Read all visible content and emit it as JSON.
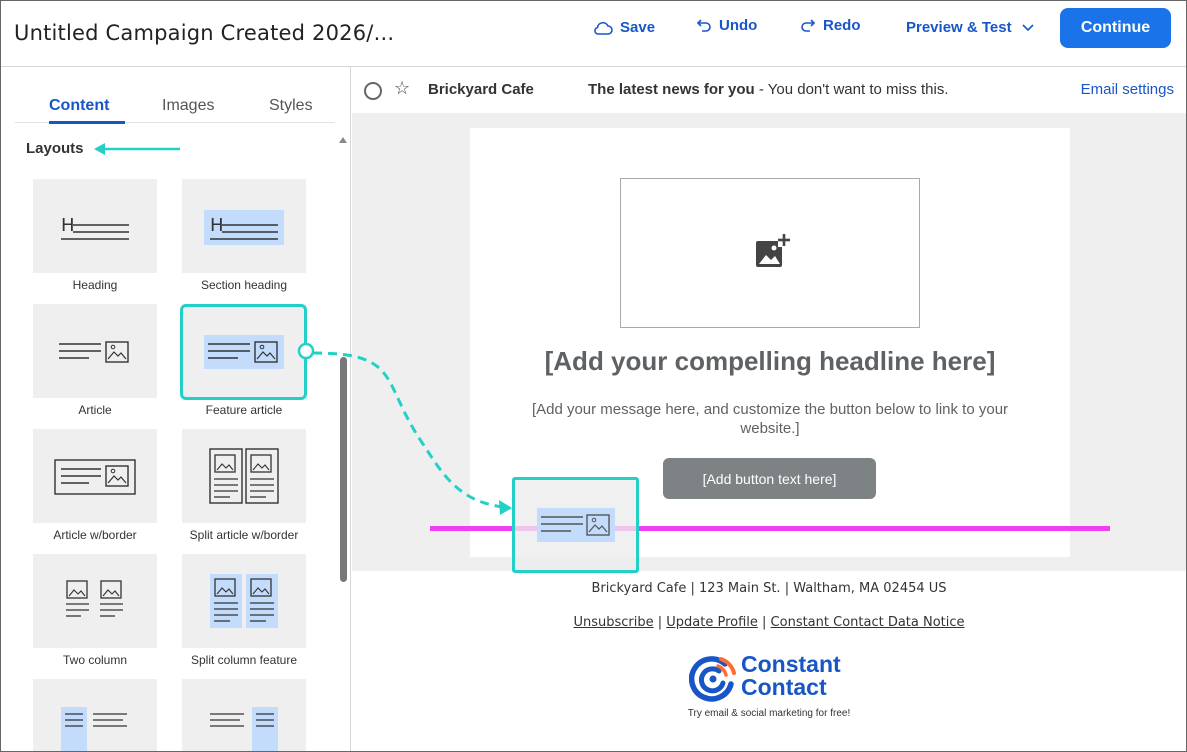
{
  "header": {
    "title": "Untitled Campaign Created 2026/...",
    "save_label": "Save",
    "undo_label": "Undo",
    "redo_label": "Redo",
    "preview_label": "Preview & Test",
    "continue_label": "Continue"
  },
  "sidebar": {
    "tabs": [
      {
        "label": "Content",
        "active": true
      },
      {
        "label": "Images",
        "active": false
      },
      {
        "label": "Styles",
        "active": false
      }
    ],
    "section_label": "Layouts",
    "layouts": [
      {
        "label": "Heading",
        "icon": "heading-layout-icon"
      },
      {
        "label": "Section heading",
        "icon": "section-heading-layout-icon"
      },
      {
        "label": "Article",
        "icon": "article-layout-icon"
      },
      {
        "label": "Feature article",
        "icon": "feature-article-layout-icon",
        "selected": true
      },
      {
        "label": "Article w/border",
        "icon": "article-border-layout-icon"
      },
      {
        "label": "Split article w/border",
        "icon": "split-article-border-layout-icon"
      },
      {
        "label": "Two column",
        "icon": "two-column-layout-icon"
      },
      {
        "label": "Split column feature",
        "icon": "split-column-feature-layout-icon"
      }
    ]
  },
  "email": {
    "sender": "Brickyard Cafe",
    "subject_bold": "The latest news for you",
    "subject_rest": " - You don't want to miss this.",
    "settings_label": "Email settings",
    "headline": "[Add your compelling headline here]",
    "message": "[Add your message here, and customize the button below to link to your website.]",
    "button_text": "[Add button text here]",
    "footer_address": "Brickyard Cafe | 123 Main St. | Waltham, MA 02454 US",
    "footer_links": [
      "Unsubscribe",
      "Update Profile",
      "Constant Contact Data Notice"
    ],
    "brand_line1": "Constant",
    "brand_line2": "Contact",
    "brand_tagline": "Try email & social marketing for free!"
  },
  "colors": {
    "accent": "#1a73e8",
    "link": "#1856c8",
    "highlight": "#23d0c8",
    "drop_line": "#f03ff0",
    "tile_fill": "#c3dcfc"
  }
}
